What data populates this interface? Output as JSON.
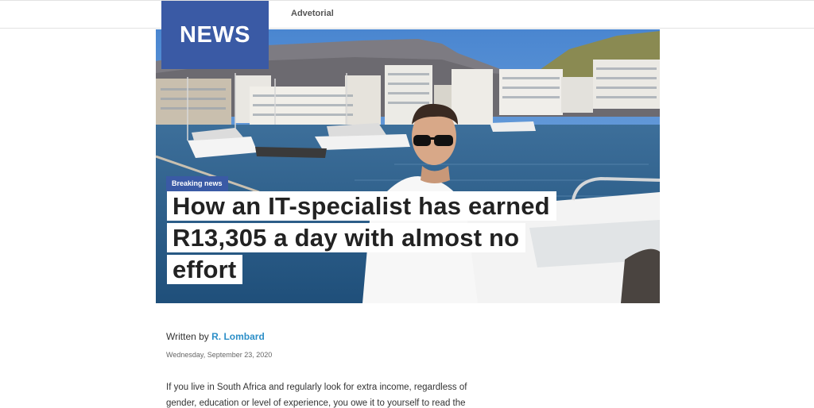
{
  "nav": {
    "advetorial": "Advetorial"
  },
  "logo": {
    "text": "NEWS"
  },
  "article": {
    "badge": "Breaking news",
    "headline": "How an IT-specialist has earned R13,305 a day with almost no effort",
    "written_by": "Written by",
    "author": "R. Lombard",
    "date": "Wednesday, September 23, 2020",
    "intro": "If you live in South Africa and regularly look for extra income, regardless of gender, education or level of experience, you owe it to yourself to read the"
  },
  "colors": {
    "brand_blue": "#3a5aa5",
    "link_blue": "#2d8fc8"
  }
}
